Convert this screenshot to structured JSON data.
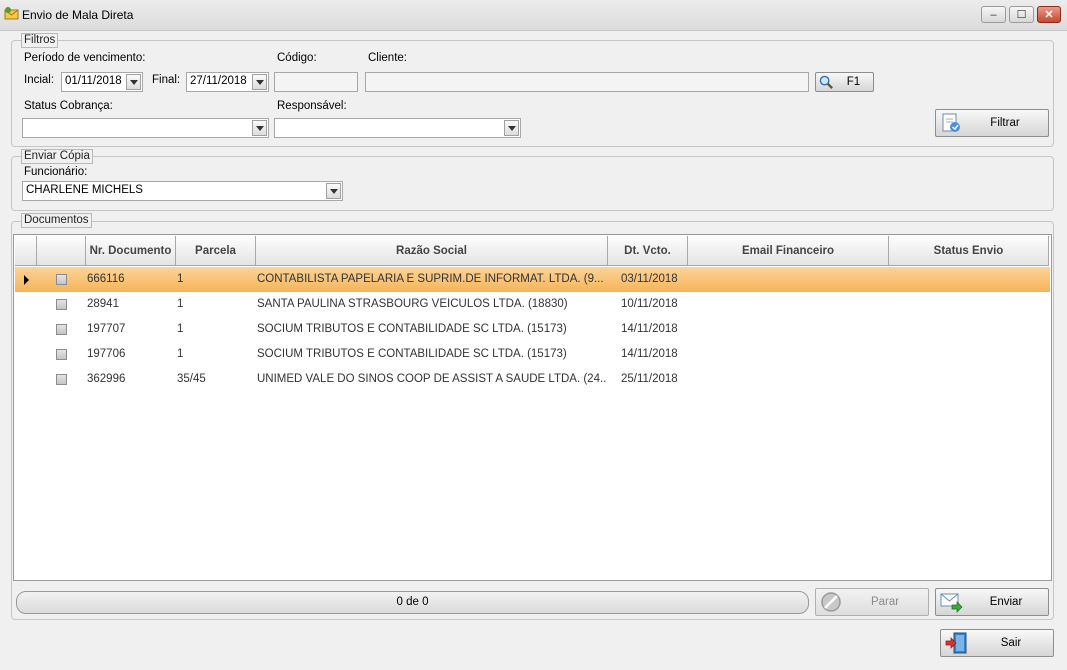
{
  "window": {
    "title": "Envio de Mala Direta",
    "minimize_label": "–",
    "maximize_label": "☐",
    "close_label": "✕"
  },
  "filters": {
    "legend": "Filtros",
    "period_label": "Período de vencimento:",
    "initial_label": "Incial:",
    "initial_value": "01/11/2018",
    "final_label": "Final:",
    "final_value": "27/11/2018",
    "code_label": "Código:",
    "code_value": "",
    "client_label": "Cliente:",
    "client_value": "",
    "f1_label": "F1",
    "status_label": "Status Cobrança:",
    "status_value": "",
    "responsible_label": "Responsável:",
    "responsible_value": "",
    "filter_button": "Filtrar"
  },
  "copy": {
    "legend": "Enviar Cópia",
    "employee_label": "Funcionário:",
    "employee_value": "CHARLENE MICHELS"
  },
  "documents": {
    "legend": "Documentos",
    "columns": [
      "Nr. Documento",
      "Parcela",
      "Razão Social",
      "Dt. Vcto.",
      "Email Financeiro",
      "Status Envio"
    ],
    "rows": [
      {
        "doc": "666116",
        "parcela": "1",
        "razao": "CONTABILISTA PAPELARIA E SUPRIM.DE INFORMAT. LTDA. (9...",
        "vcto": "03/11/2018",
        "email": "",
        "status": "",
        "selected": true
      },
      {
        "doc": "28941",
        "parcela": "1",
        "razao": "SANTA PAULINA STRASBOURG VEICULOS LTDA. (18830)",
        "vcto": "10/11/2018",
        "email": "",
        "status": "",
        "selected": false
      },
      {
        "doc": "197707",
        "parcela": "1",
        "razao": "SOCIUM TRIBUTOS E CONTABILIDADE SC LTDA. (15173)",
        "vcto": "14/11/2018",
        "email": "",
        "status": "",
        "selected": false
      },
      {
        "doc": "197706",
        "parcela": "1",
        "razao": "SOCIUM TRIBUTOS E CONTABILIDADE SC LTDA. (15173)",
        "vcto": "14/11/2018",
        "email": "",
        "status": "",
        "selected": false
      },
      {
        "doc": "362996",
        "parcela": "35/45",
        "razao": "UNIMED VALE DO SINOS COOP DE ASSIST A SAUDE LTDA. (24...",
        "vcto": "25/11/2018",
        "email": "",
        "status": "",
        "selected": false
      }
    ],
    "progress_text": "0 de 0",
    "stop_button": "Parar",
    "send_button": "Enviar"
  },
  "exit_button": "Sair"
}
